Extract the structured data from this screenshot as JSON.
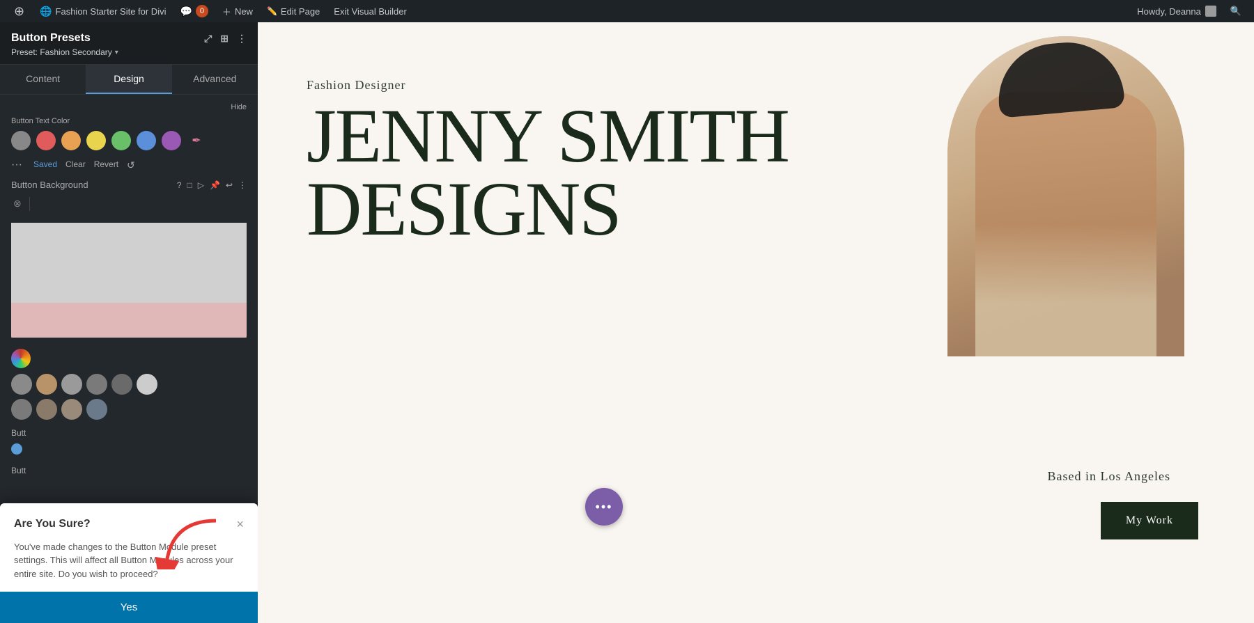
{
  "adminBar": {
    "site_name": "Fashion Starter Site for Divi",
    "comment_count": "0",
    "new_label": "New",
    "edit_page_label": "Edit Page",
    "exit_builder_label": "Exit Visual Builder",
    "howdy_text": "Howdy, Deanna"
  },
  "panel": {
    "title": "Button Presets",
    "preset_label": "Preset: Fashion Secondary",
    "icons": [
      "⤢",
      "⊞",
      "⋮"
    ],
    "tabs": [
      {
        "label": "Content",
        "active": false
      },
      {
        "label": "Design",
        "active": true
      },
      {
        "label": "Advanced",
        "active": false
      }
    ],
    "button_text_color_label": "Button Text Color",
    "button_background_label": "Button Background",
    "saved_label": "Saved",
    "clear_label": "Clear",
    "revert_label": "Revert"
  },
  "modal": {
    "title": "Are You Sure?",
    "body": "You've made changes to the Button Module preset settings. This will affect all Button Modules across your entire site. Do you wish to proceed?",
    "yes_label": "Yes",
    "close_icon": "×"
  },
  "canvas": {
    "subtitle": "Fashion Designer",
    "title_line1": "JENNY SMITH",
    "title_line2": "DESIGNS",
    "based_text": "Based in Los Angeles",
    "my_work_label": "My Work",
    "fab_icon": "•••"
  },
  "colors": {
    "swatches": [
      "#888888",
      "#e05c5c",
      "#e8a052",
      "#e8d44d",
      "#6abf69",
      "#5b8fd9",
      "#9b59b6"
    ],
    "gradient_row1": [
      "#8a8a8a",
      "#b8936a",
      "#9a9a9a",
      "#7a7a7a",
      "#6a6a6a"
    ],
    "gradient_row2": [
      "#7a7a7a",
      "#8a7a6a",
      "#9a8a7a",
      "#6a7a8a"
    ]
  }
}
